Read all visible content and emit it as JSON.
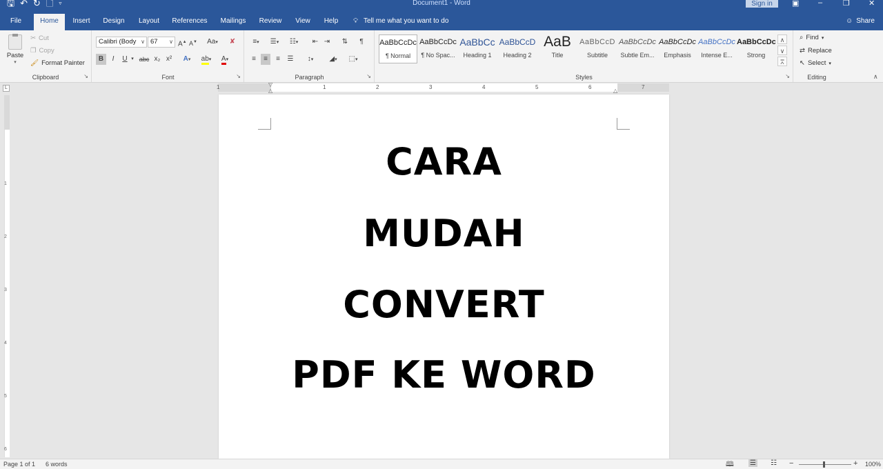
{
  "window": {
    "title": "Document1 - Word",
    "sign_in": "Sign in",
    "qat_icons": [
      "save-icon",
      "undo-icon",
      "redo-icon",
      "new-doc-icon",
      "customize-qat-icon"
    ],
    "controls": [
      "ribbon-display-icon",
      "minimize-icon",
      "restore-icon",
      "close-icon"
    ]
  },
  "tabs": [
    {
      "label": "File"
    },
    {
      "label": "Home"
    },
    {
      "label": "Insert"
    },
    {
      "label": "Design"
    },
    {
      "label": "Layout"
    },
    {
      "label": "References"
    },
    {
      "label": "Mailings"
    },
    {
      "label": "Review"
    },
    {
      "label": "View"
    },
    {
      "label": "Help"
    }
  ],
  "active_tab": "Home",
  "tell_me": "Tell me what you want to do",
  "share": "Share",
  "ribbon": {
    "clipboard": {
      "label": "Clipboard",
      "paste": "Paste",
      "cut": "Cut",
      "copy": "Copy",
      "format_painter": "Format Painter"
    },
    "font": {
      "label": "Font",
      "font_name": "Calibri (Body",
      "font_size": "67",
      "bold": "B",
      "italic": "I",
      "underline": "U",
      "strikethrough": "abc",
      "subscript": "x₂",
      "superscript": "x²",
      "grow": "A",
      "shrink": "A",
      "change_case": "Aa",
      "text_effects": "A",
      "font_color": "A"
    },
    "paragraph": {
      "label": "Paragraph",
      "show_marks": "¶"
    },
    "styles": {
      "label": "Styles",
      "items": [
        {
          "sample": "AaBbCcDc",
          "name": "¶ Normal"
        },
        {
          "sample": "AaBbCcDc",
          "name": "¶ No Spac..."
        },
        {
          "sample": "AaBbCc",
          "name": "Heading 1"
        },
        {
          "sample": "AaBbCcD",
          "name": "Heading 2"
        },
        {
          "sample": "AaB",
          "name": "Title"
        },
        {
          "sample": "AaBbCcD",
          "name": "Subtitle"
        },
        {
          "sample": "AaBbCcDc",
          "name": "Subtle Em..."
        },
        {
          "sample": "AaBbCcDc",
          "name": "Emphasis"
        },
        {
          "sample": "AaBbCcDc",
          "name": "Intense E..."
        },
        {
          "sample": "AaBbCcDc",
          "name": "Strong"
        }
      ]
    },
    "editing": {
      "label": "Editing",
      "find": "Find",
      "replace": "Replace",
      "select": "Select"
    }
  },
  "ruler": {
    "h_numbers": [
      "1",
      "1",
      "2",
      "3",
      "4",
      "5",
      "6",
      "7"
    ],
    "v_numbers": [
      "1",
      "2",
      "3",
      "4",
      "5",
      "6"
    ]
  },
  "document": {
    "lines": [
      "CARA",
      "MUDAH",
      "CONVERT",
      "PDF KE WORD"
    ]
  },
  "status": {
    "page": "Page 1 of 1",
    "words": "6 words",
    "zoom": "100%"
  },
  "colors": {
    "brand": "#2b579a",
    "ribbon_bg": "#f3f3f3",
    "canvas_bg": "#e6e6e6",
    "highlight": "#ffff00",
    "font_color": "#e00000"
  }
}
